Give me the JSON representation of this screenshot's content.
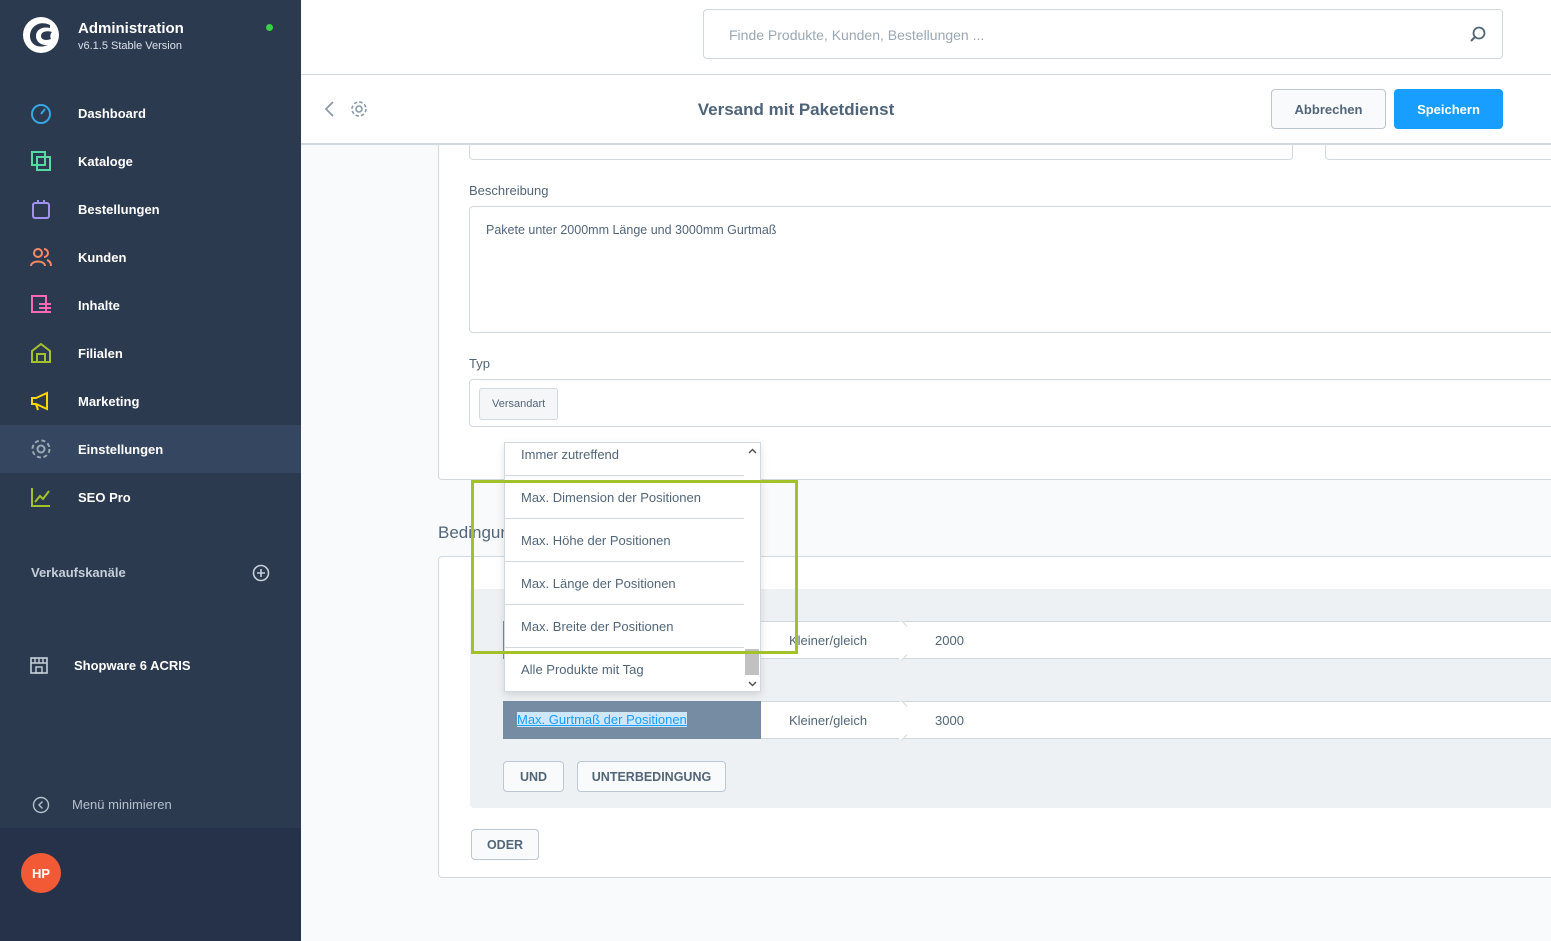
{
  "sidebar": {
    "title": "Administration",
    "version": "v6.1.5 Stable Version",
    "items": [
      {
        "label": "Dashboard",
        "icon": "dashboard-icon",
        "color": "#36a7e0"
      },
      {
        "label": "Kataloge",
        "icon": "catalog-icon",
        "color": "#57d9a3"
      },
      {
        "label": "Bestellungen",
        "icon": "orders-icon",
        "color": "#a092f0"
      },
      {
        "label": "Kunden",
        "icon": "customers-icon",
        "color": "#f88962"
      },
      {
        "label": "Inhalte",
        "icon": "content-icon",
        "color": "#ff68b4"
      },
      {
        "label": "Filialen",
        "icon": "store-icon",
        "color": "#a3c12a"
      },
      {
        "label": "Marketing",
        "icon": "marketing-icon",
        "color": "#ffd700"
      },
      {
        "label": "Einstellungen",
        "icon": "settings-icon",
        "color": "#9aa8b5"
      },
      {
        "label": "SEO Pro",
        "icon": "seo-icon",
        "color": "#a3c12a"
      }
    ],
    "active_item": "Einstellungen",
    "sales_channels_label": "Verkaufskanäle",
    "sales_channel": "Shopware 6 ACRIS",
    "minimize_label": "Menü minimieren",
    "user_initials": "HP"
  },
  "search": {
    "placeholder": "Finde Produkte, Kunden, Bestellungen ..."
  },
  "smartbar": {
    "title": "Versand mit Paketdienst",
    "cancel_label": "Abbrechen",
    "save_label": "Speichern"
  },
  "form": {
    "description_label": "Beschreibung",
    "description_value": "Pakete unter 2000mm Länge und 3000mm Gurtmaß",
    "type_label": "Typ",
    "type_tag": "Versandart"
  },
  "conditions": {
    "title": "Bedingun",
    "rows": [
      {
        "field": "",
        "operator": "Kleiner/gleich",
        "value": "2000"
      },
      {
        "field": "Max. Gurtmaß der Positionen",
        "operator": "Kleiner/gleich",
        "value": "3000"
      }
    ],
    "and_label": "UND",
    "subcondition_label": "UNTERBEDINGUNG",
    "or_label": "ODER"
  },
  "dropdown": {
    "options": [
      "Immer zutreffend",
      "Max. Dimension der Positionen",
      "Max. Höhe der Positionen",
      "Max. Länge der Positionen",
      "Max. Breite der Positionen",
      "Alle Produkte mit Tag"
    ]
  },
  "colors": {
    "sidebar_bg": "#2c3a4f",
    "primary": "#189eff",
    "highlight": "#a3c12a",
    "condition_field_bg": "#758ca3",
    "status_online": "#37d046",
    "avatar": "#f25a36"
  }
}
